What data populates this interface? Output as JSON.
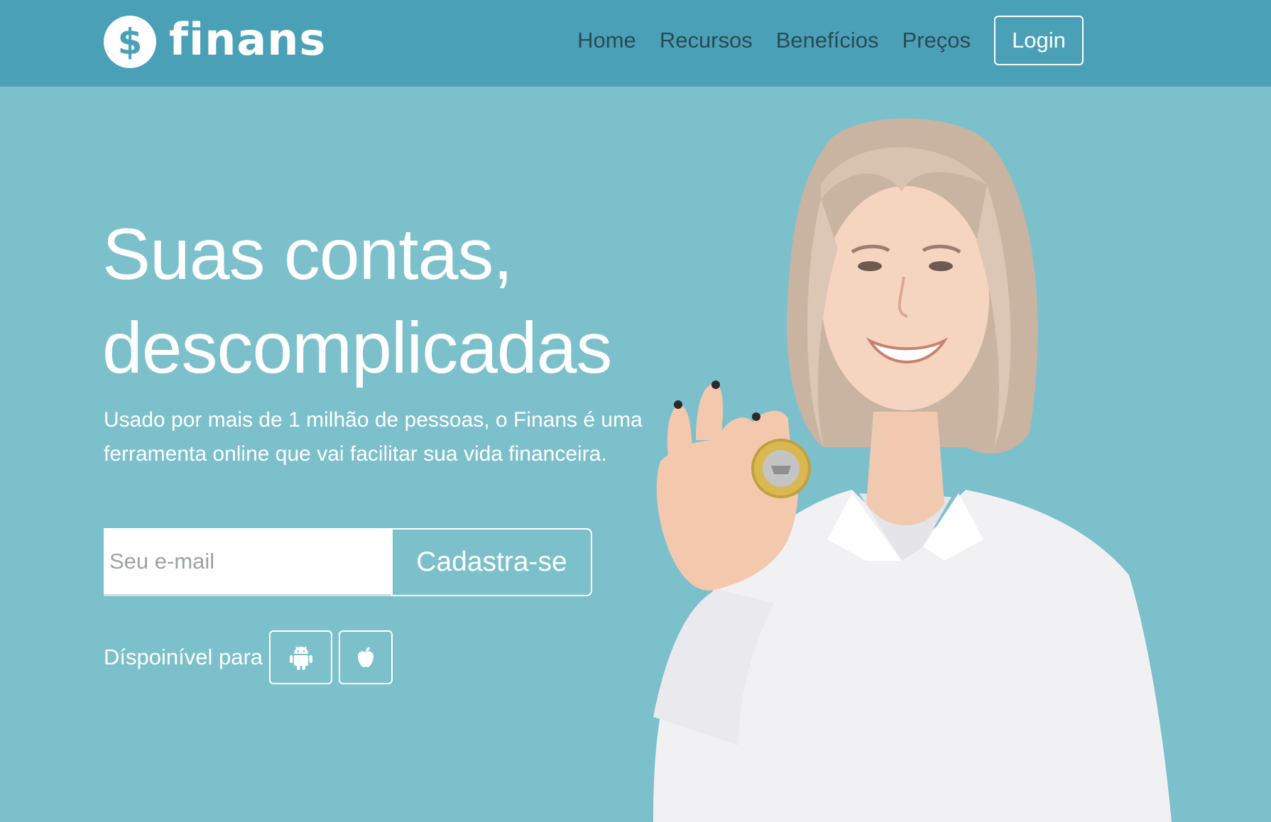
{
  "header": {
    "brand": {
      "name": "finans",
      "mark_symbol": "$",
      "icon": "dollar-circle-icon"
    },
    "nav": [
      {
        "label": "Home"
      },
      {
        "label": "Recursos"
      },
      {
        "label": "Benefícios"
      },
      {
        "label": "Preços"
      }
    ],
    "login_label": "Login"
  },
  "hero": {
    "headline_line1": "Suas contas,",
    "headline_line2": "descomplicadas",
    "description": "Usado por mais de 1 milhão de pessoas, o Finans é uma ferramenta online que vai facilitar sua vida financeira.",
    "signup": {
      "email_placeholder": "Seu e-mail",
      "email_value": "",
      "button_label": "Cadastra-se"
    },
    "available": {
      "label": "Díspoinível para",
      "platforms": [
        {
          "name": "Android",
          "icon": "android-icon"
        },
        {
          "name": "Apple",
          "icon": "apple-icon"
        }
      ]
    }
  },
  "colors": {
    "header_bg": "#4aa0b6",
    "hero_bg": "#7cc0cc",
    "nav_text": "#2b4a55",
    "text_light": "#ffffff"
  }
}
